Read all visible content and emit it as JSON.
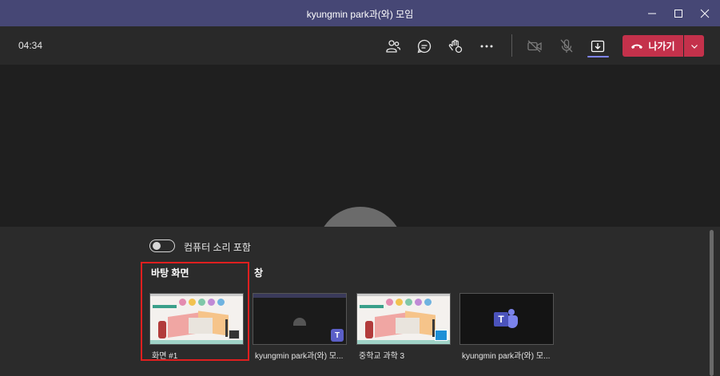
{
  "window": {
    "title": "kyungmin park과(와) 모임",
    "controls": [
      "minimize-icon",
      "maximize-icon",
      "close-icon"
    ]
  },
  "toolbar": {
    "timer": "04:34",
    "icons": [
      "participants-icon",
      "chat-icon",
      "raise-hand-icon",
      "more-icon",
      "camera-off-icon",
      "mic-off-icon",
      "share-screen-icon"
    ],
    "leave_label": "나가기",
    "leave_color": "#c4314b",
    "accent": "#7f85f5"
  },
  "share_tray": {
    "toggle_label": "컴퓨터 소리 포함",
    "toggle_on": false,
    "desktop_section": "바탕 화면",
    "window_section": "창",
    "selected_border": "#e01f1f",
    "desktops": [
      {
        "caption": "화면 #1"
      }
    ],
    "windows": [
      {
        "caption": "kyungmin park과(와) 모..."
      },
      {
        "caption": "중학교 과학 3"
      },
      {
        "caption": "kyungmin park과(와) 모..."
      }
    ]
  }
}
